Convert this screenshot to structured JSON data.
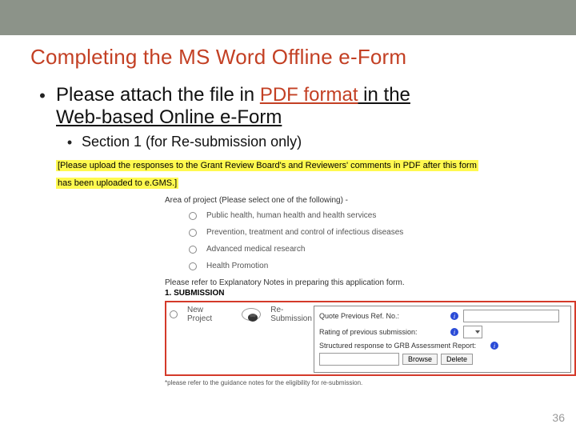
{
  "title": "Completing the MS Word Offline e-Form",
  "bullet1": {
    "pre": "Please attach the file in ",
    "em": "PDF format",
    "post_a": " in the",
    "post_b": "Web-based Online e-Form"
  },
  "bullet2": "Section 1 (for Re-submission only)",
  "highlight_a": "[Please upload the responses to the Grant Review Board's and Reviewers' comments in PDF after this form",
  "highlight_b": "has been uploaded to e.GMS.]",
  "form": {
    "head": "Area of project (Please select one of the following) -",
    "opts": [
      "Public health, human health and health services",
      "Prevention, treatment and control of infectious diseases",
      "Advanced medical research",
      "Health Promotion"
    ],
    "note": "Please refer to Explanatory Notes in preparing this application form.",
    "section_h": "1. SUBMISSION",
    "new_project": "New Project",
    "resub": "Re-Submission",
    "r1": "Quote Previous Ref. No.:",
    "r2": "Rating of previous submission:",
    "r3": "Structured response to GRB Assessment Report:",
    "browse": "Browse",
    "delete": "Delete"
  },
  "footnote": "*please refer to the guidance notes for the eligibility for re-submission.",
  "pagenum": "36"
}
